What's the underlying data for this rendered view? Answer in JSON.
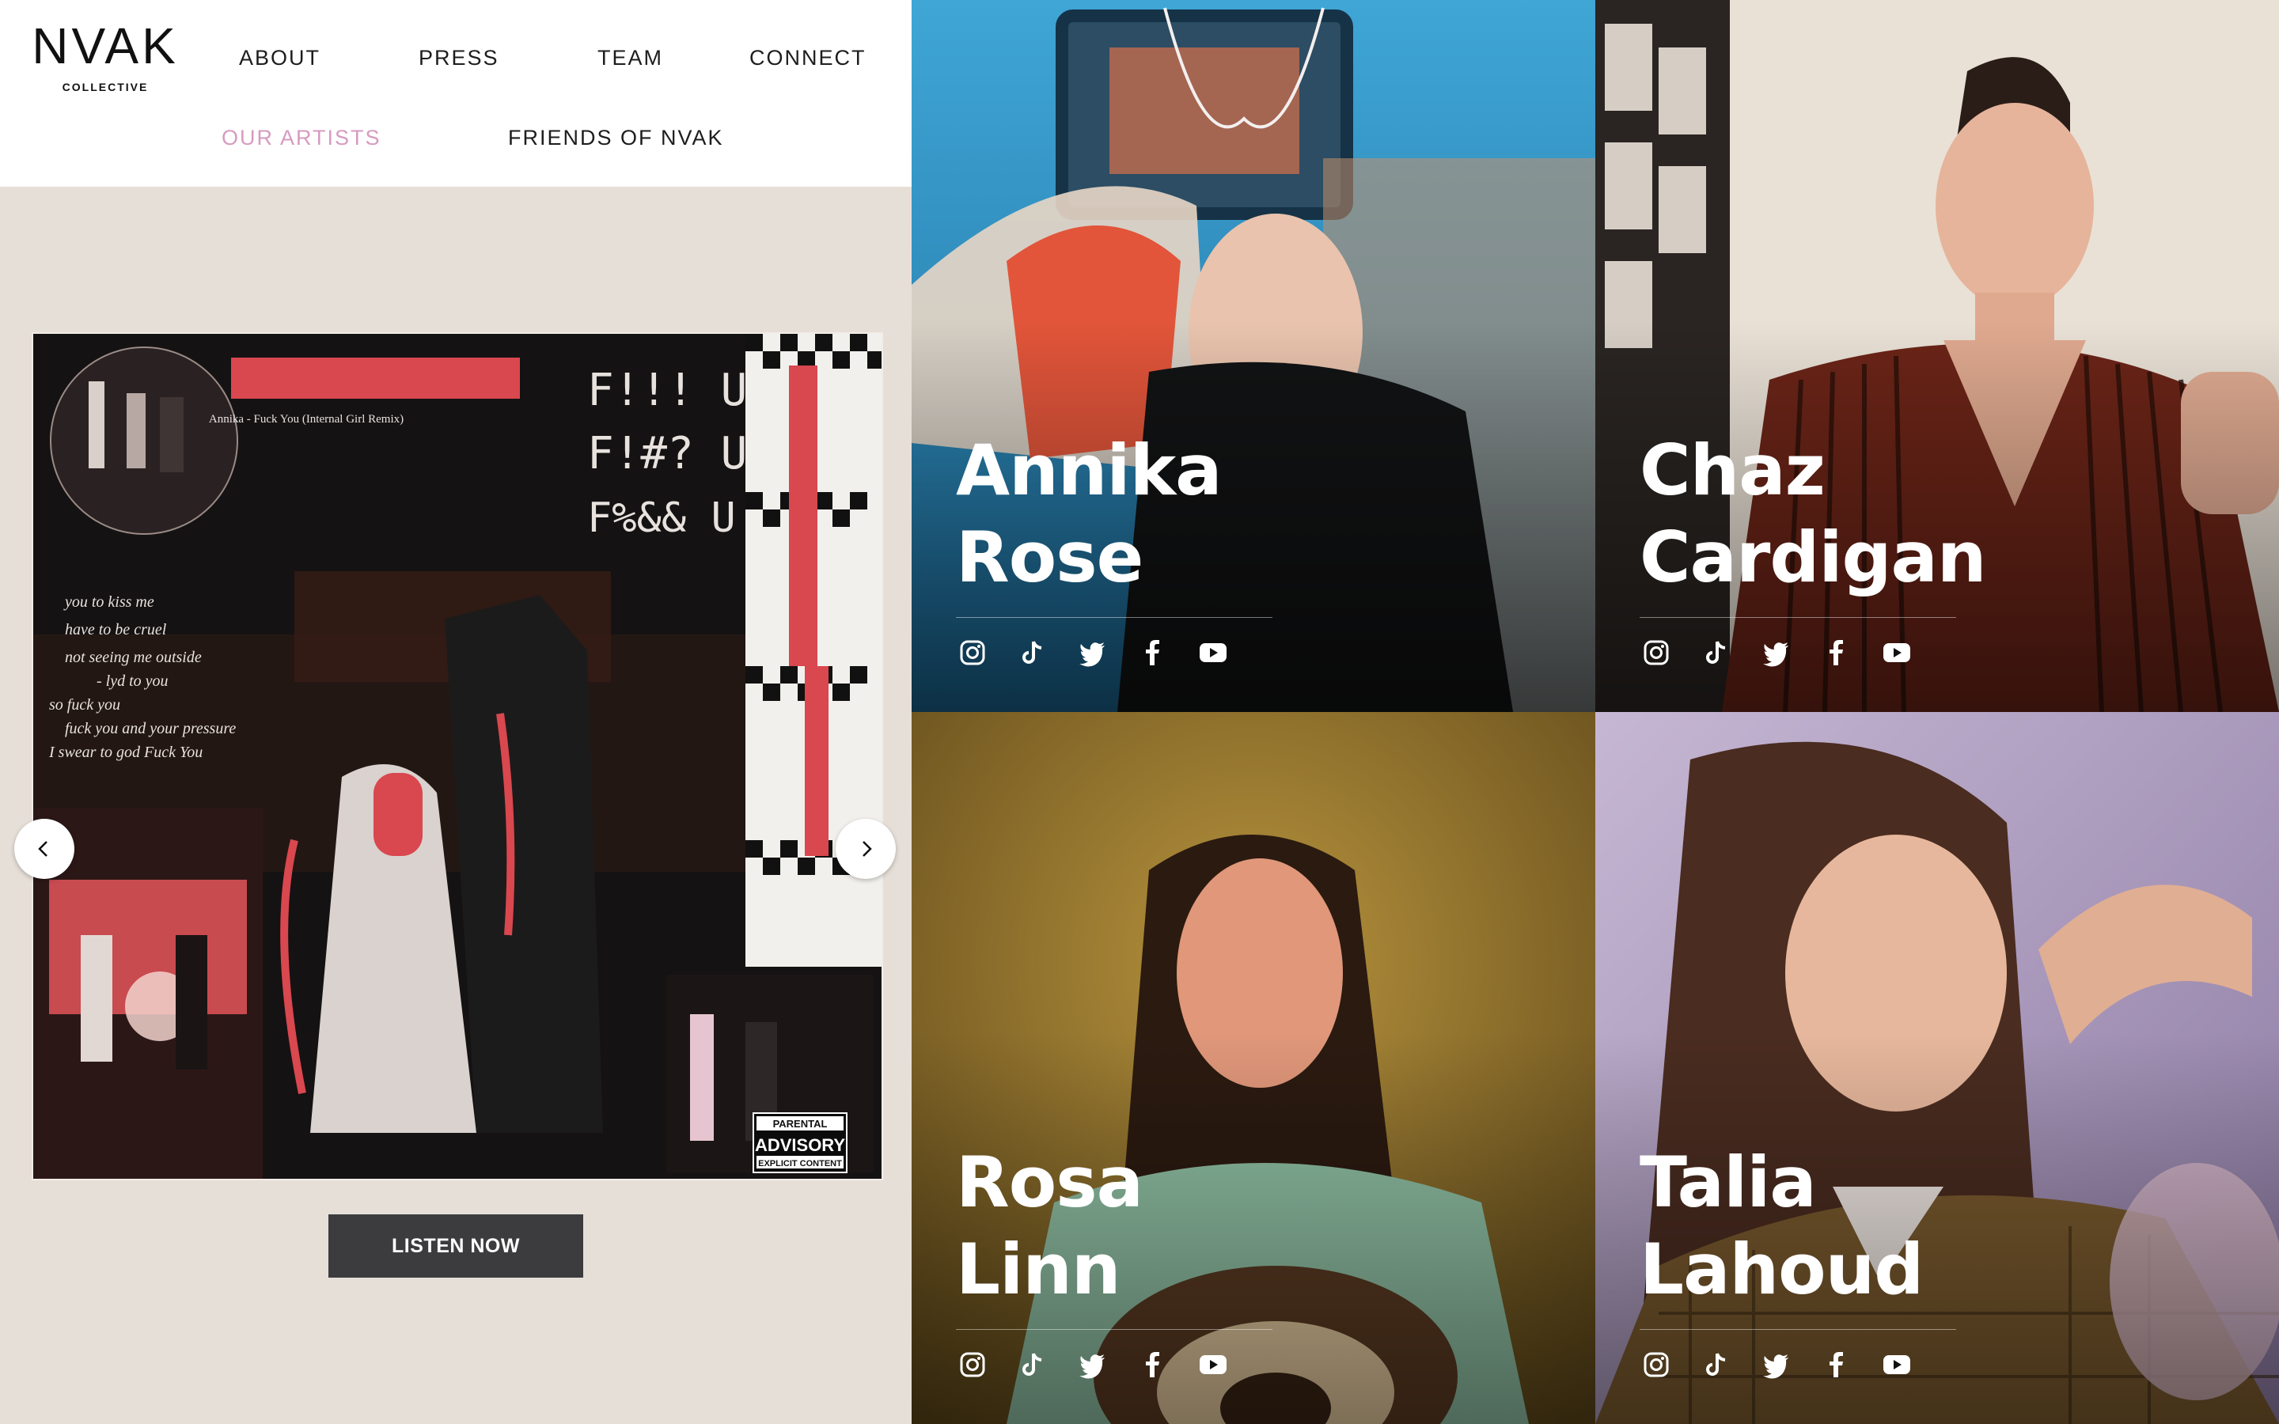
{
  "logo": {
    "main": "NVAK",
    "sub": "COLLECTIVE"
  },
  "nav": {
    "about": "ABOUT",
    "press": "PRESS",
    "team": "TEAM",
    "connect": "CONNECT",
    "our_artists": "OUR ARTISTS",
    "friends": "FRIENDS OF NVAK"
  },
  "album": {
    "handwritten_lines": [
      "F!!! U",
      "F!#? U",
      "F%&& U"
    ],
    "title_strip": "Annika - Fuck You (Internal Girl Remix)",
    "lyrics": [
      "you to kiss me",
      "have to be cruel",
      "not seeing me outside",
      "- lyd to you",
      "so fuck you",
      "fuck you and your pressure",
      "I swear to god Fuck You"
    ],
    "advisory_top": "PARENTAL",
    "advisory_mid": "ADVISORY",
    "advisory_bottom": "EXPLICIT CONTENT"
  },
  "carousel": {
    "listen_label": "LISTEN NOW"
  },
  "artists": [
    {
      "first": "Annika",
      "last": "Rose"
    },
    {
      "first": "Chaz",
      "last": "Cardigan"
    },
    {
      "first": "Rosa",
      "last": "Linn"
    },
    {
      "first": "Talia",
      "last": "Lahoud"
    }
  ],
  "social_icons": [
    "instagram-icon",
    "tiktok-icon",
    "twitter-icon",
    "facebook-icon",
    "youtube-icon"
  ],
  "colors": {
    "active_nav": "#d69bc1",
    "button_bg": "#3c3c3e",
    "page_bg": "#e6dfd8"
  }
}
